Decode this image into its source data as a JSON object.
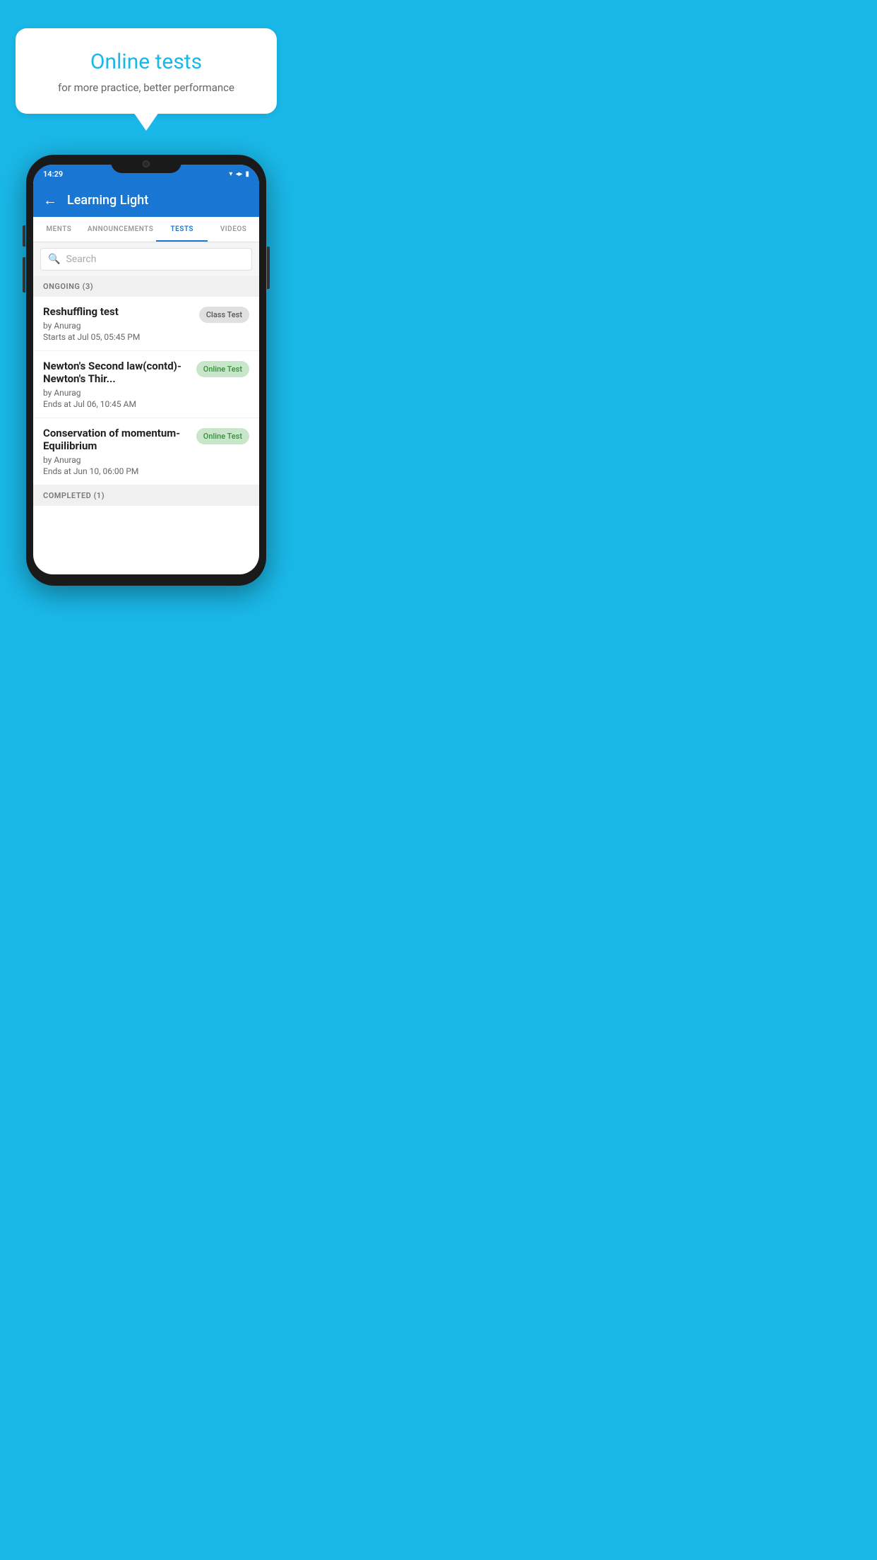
{
  "background": {
    "color": "#1ab8e8"
  },
  "bubble": {
    "title": "Online tests",
    "subtitle": "for more practice, better performance"
  },
  "phone": {
    "status_bar": {
      "time": "14:29"
    },
    "app_bar": {
      "title": "Learning Light",
      "back_label": "←"
    },
    "tabs": [
      {
        "label": "MENTS",
        "active": false
      },
      {
        "label": "ANNOUNCEMENTS",
        "active": false
      },
      {
        "label": "TESTS",
        "active": true
      },
      {
        "label": "VIDEOS",
        "active": false
      }
    ],
    "search": {
      "placeholder": "Search"
    },
    "sections": [
      {
        "header": "ONGOING (3)",
        "items": [
          {
            "name": "Reshuffling test",
            "author": "by Anurag",
            "date_label": "Starts at  Jul 05, 05:45 PM",
            "badge": "Class Test",
            "badge_type": "class"
          },
          {
            "name": "Newton's Second law(contd)-Newton's Thir...",
            "author": "by Anurag",
            "date_label": "Ends at  Jul 06, 10:45 AM",
            "badge": "Online Test",
            "badge_type": "online"
          },
          {
            "name": "Conservation of momentum-Equilibrium",
            "author": "by Anurag",
            "date_label": "Ends at  Jun 10, 06:00 PM",
            "badge": "Online Test",
            "badge_type": "online"
          }
        ]
      }
    ],
    "completed_header": "COMPLETED (1)"
  }
}
